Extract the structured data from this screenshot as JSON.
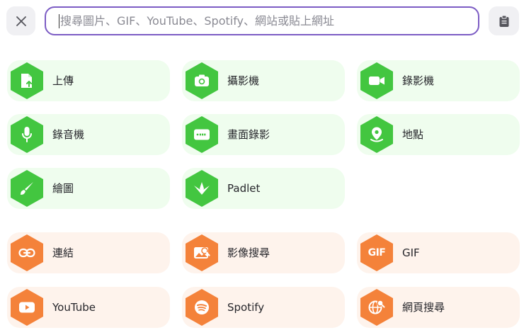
{
  "search": {
    "placeholder": "搜尋圖片、GIF、YouTube、Spotify、網站或貼上網址",
    "value": ""
  },
  "colors": {
    "accent_border": "#7c5cc4",
    "green_icon": "#43c640",
    "green_bg": "#effdee",
    "orange_icon": "#f4823a",
    "orange_bg": "#fef3ec"
  },
  "icons": {
    "close": "close-icon",
    "paste": "clipboard-icon"
  },
  "options": [
    {
      "label": "上傳",
      "icon": "upload-file-icon",
      "color": "green"
    },
    {
      "label": "攝影機",
      "icon": "camera-icon",
      "color": "green"
    },
    {
      "label": "錄影機",
      "icon": "video-camera-icon",
      "color": "green"
    },
    {
      "label": "錄音機",
      "icon": "microphone-icon",
      "color": "green"
    },
    {
      "label": "畫面錄影",
      "icon": "screen-record-icon",
      "color": "green"
    },
    {
      "label": "地點",
      "icon": "location-pin-icon",
      "color": "green"
    },
    {
      "label": "繪圖",
      "icon": "brush-icon",
      "color": "green"
    },
    {
      "label": "Padlet",
      "icon": "padlet-logo-icon",
      "color": "green"
    },
    {
      "label": "連結",
      "icon": "link-icon",
      "color": "orange"
    },
    {
      "label": "影像搜尋",
      "icon": "image-search-icon",
      "color": "orange"
    },
    {
      "label": "GIF",
      "icon": "gif-icon",
      "color": "orange",
      "icon_text": "GIF"
    },
    {
      "label": "YouTube",
      "icon": "youtube-icon",
      "color": "orange"
    },
    {
      "label": "Spotify",
      "icon": "spotify-icon",
      "color": "orange"
    },
    {
      "label": "網頁搜尋",
      "icon": "web-search-icon",
      "color": "orange"
    }
  ]
}
